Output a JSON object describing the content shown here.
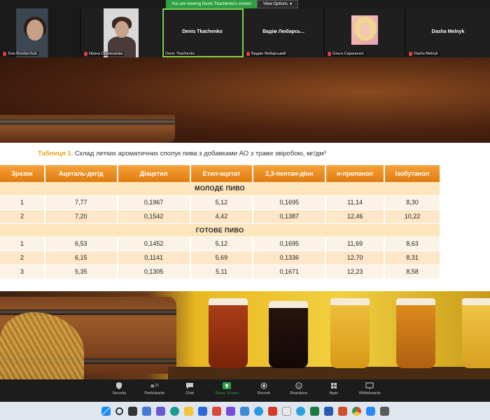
{
  "banner": {
    "message": "You are viewing Denis Tkachenko's screen",
    "options_label": "View Options"
  },
  "participants": [
    {
      "name": "Zoia Bondarchuk",
      "big_name": ""
    },
    {
      "name": "Ирина Осипенкова",
      "big_name": ""
    },
    {
      "name": "Denis Tkachenko",
      "big_name": "Denis Tkachenko"
    },
    {
      "name": "Вадим Любарський",
      "big_name": "Вадім Любарсь..."
    },
    {
      "name": "Ольга Сараненко",
      "big_name": ""
    },
    {
      "name": "Dasha Melnyk",
      "big_name": "Dasha Melnyk"
    }
  ],
  "slide": {
    "caption_lead": "Таблиця 1.",
    "caption_text": " Склад летких ароматичних сполук пива з добавками АО з трави звіробою, мг/дм³",
    "columns": [
      "Зразок",
      "Ацеталь-дегід",
      "Діацетил",
      "Етил-ацетат",
      "2,3-пентан-діон",
      "н-пропанол",
      "Ізобутанол"
    ],
    "section_young": "МОЛОДЕ ПИВО",
    "section_ready": "ГОТОВЕ ПИВО",
    "young_rows": [
      [
        "1",
        "7,77",
        "0,1967",
        "5,12",
        "0,1695",
        "11,14",
        "8,30"
      ],
      [
        "2",
        "7,20",
        "0,1542",
        "4,42",
        "0,1387",
        "12,46",
        "10,22"
      ]
    ],
    "ready_rows": [
      [
        "1",
        "6,53",
        "0,1452",
        "5,12",
        "0,1695",
        "11,69",
        "8,63"
      ],
      [
        "2",
        "6,15",
        "0,1141",
        "5,69",
        "0,1336",
        "12,70",
        "8,31"
      ],
      [
        "3",
        "5,35",
        "0,1305",
        "5,11",
        "0,1671",
        "12,23",
        "8,58"
      ]
    ]
  },
  "toolbar": {
    "security": "Security",
    "participants": "Participants",
    "participants_count": "26",
    "chat": "Chat",
    "share": "Share Screen",
    "record": "Record",
    "reactions": "Reactions",
    "apps": "Apps",
    "whiteboards": "Whiteboards"
  },
  "colors": {
    "accent": "#e07c10",
    "share_green": "#2ea043",
    "mic_off": "#e04040"
  }
}
